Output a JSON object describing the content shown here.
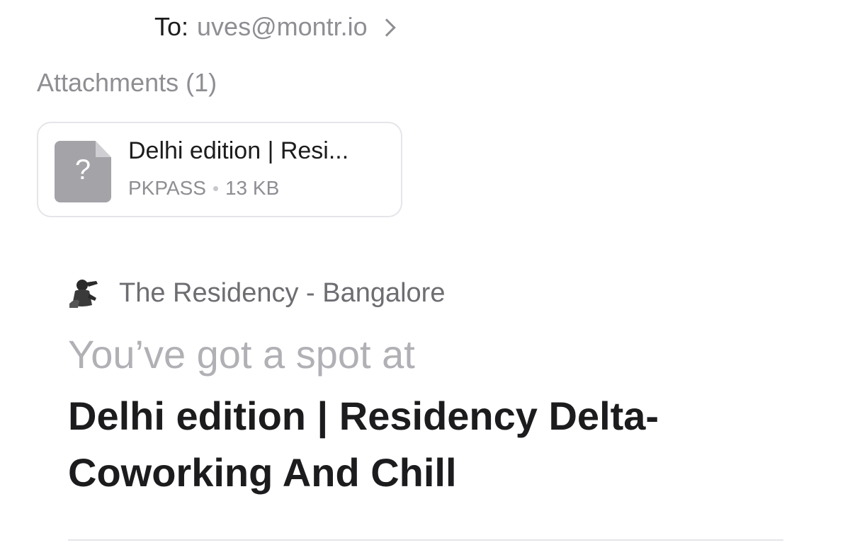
{
  "recipient": {
    "label": "To:",
    "value": "uves@montr.io",
    "chevron_icon": "chevron-right-icon"
  },
  "attachments": {
    "header": "Attachments (1)",
    "items": [
      {
        "name": "Delhi edition | Resi...",
        "type": "PKPASS",
        "size": "13 KB",
        "icon": "unknown-file-icon",
        "icon_glyph": "?"
      }
    ]
  },
  "sender": {
    "name": "The Residency - Bangalore",
    "avatar_icon": "silhouette-avatar-icon"
  },
  "headline": {
    "lead": "You’ve got a spot at",
    "title": "Delhi edition | Residency Delta-Coworking And Chill"
  },
  "colors": {
    "primary_text": "#1c1c1e",
    "secondary_text": "#8e8e93",
    "muted_headline": "#b0b0b5",
    "card_border": "#e5e5ea",
    "file_icon": "#a3a3a8"
  }
}
